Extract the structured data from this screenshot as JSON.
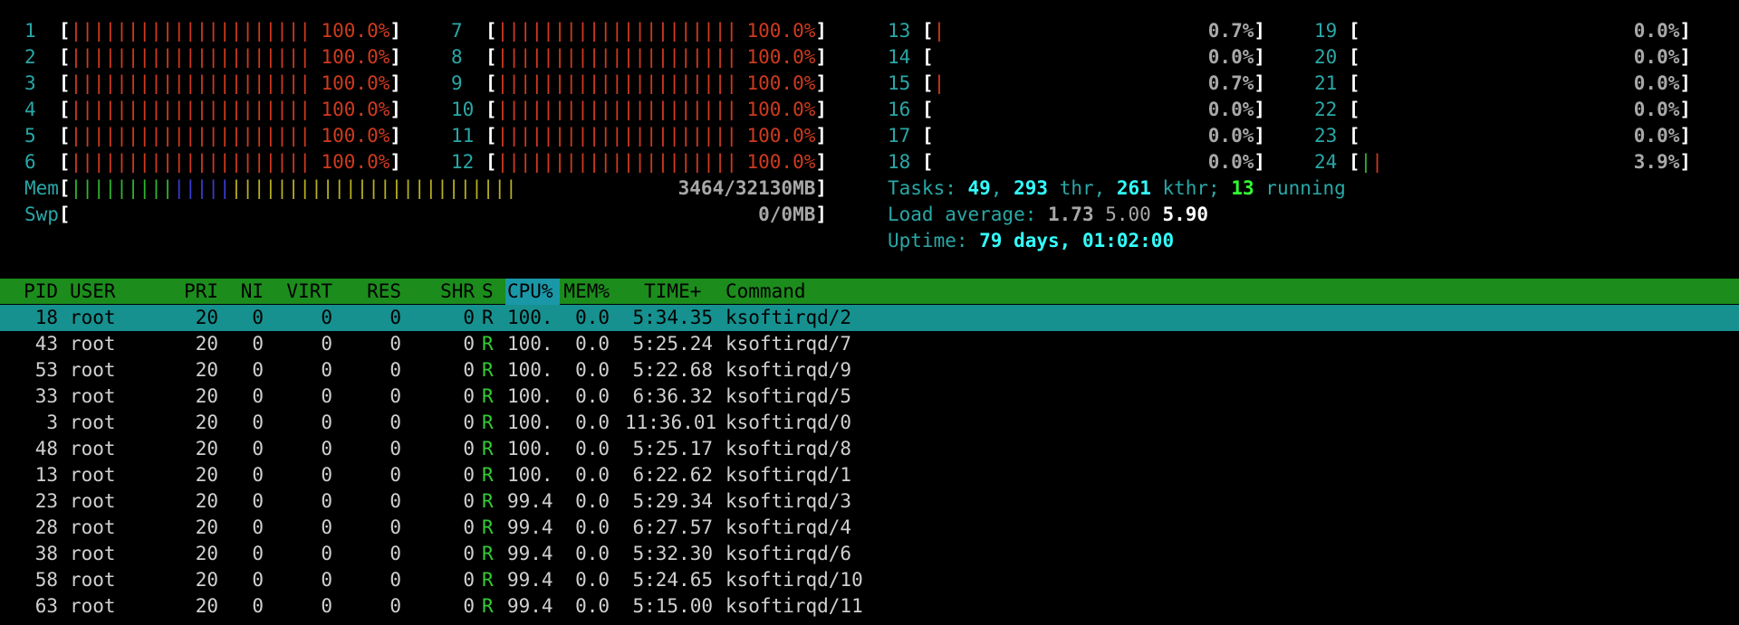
{
  "colors": {
    "label": "#2aa7a7",
    "kernel_bar": "#d03a1e",
    "normal_bar": "#2fb52f",
    "mem_used": "#2fb52f",
    "mem_buffers": "#3b3bd0",
    "mem_cache": "#b8b020",
    "header_bg": "#1c8c1c",
    "selected_bg": "#16918f"
  },
  "cpus": [
    {
      "label": "1",
      "value": "100.0%",
      "pct": 100,
      "segments": [
        {
          "type": "kernel",
          "pct": 100
        }
      ]
    },
    {
      "label": "2",
      "value": "100.0%",
      "pct": 100,
      "segments": [
        {
          "type": "kernel",
          "pct": 100
        }
      ]
    },
    {
      "label": "3",
      "value": "100.0%",
      "pct": 100,
      "segments": [
        {
          "type": "kernel",
          "pct": 100
        }
      ]
    },
    {
      "label": "4",
      "value": "100.0%",
      "pct": 100,
      "segments": [
        {
          "type": "kernel",
          "pct": 100
        }
      ]
    },
    {
      "label": "5",
      "value": "100.0%",
      "pct": 100,
      "segments": [
        {
          "type": "kernel",
          "pct": 100
        }
      ]
    },
    {
      "label": "6",
      "value": "100.0%",
      "pct": 100,
      "segments": [
        {
          "type": "kernel",
          "pct": 100
        }
      ]
    },
    {
      "label": "7",
      "value": "100.0%",
      "pct": 100,
      "segments": [
        {
          "type": "kernel",
          "pct": 100
        }
      ]
    },
    {
      "label": "8",
      "value": "100.0%",
      "pct": 100,
      "segments": [
        {
          "type": "kernel",
          "pct": 100
        }
      ]
    },
    {
      "label": "9",
      "value": "100.0%",
      "pct": 100,
      "segments": [
        {
          "type": "kernel",
          "pct": 100
        }
      ]
    },
    {
      "label": "10",
      "value": "100.0%",
      "pct": 100,
      "segments": [
        {
          "type": "kernel",
          "pct": 100
        }
      ]
    },
    {
      "label": "11",
      "value": "100.0%",
      "pct": 100,
      "segments": [
        {
          "type": "kernel",
          "pct": 100
        }
      ]
    },
    {
      "label": "12",
      "value": "100.0%",
      "pct": 100,
      "segments": [
        {
          "type": "kernel",
          "pct": 100
        }
      ]
    },
    {
      "label": "13",
      "value": "0.7%",
      "pct": 0.7,
      "segments": [
        {
          "type": "kernel",
          "pct": 0.7
        }
      ]
    },
    {
      "label": "14",
      "value": "0.0%",
      "pct": 0,
      "segments": []
    },
    {
      "label": "15",
      "value": "0.7%",
      "pct": 0.7,
      "segments": [
        {
          "type": "kernel",
          "pct": 0.7
        }
      ]
    },
    {
      "label": "16",
      "value": "0.0%",
      "pct": 0,
      "segments": []
    },
    {
      "label": "17",
      "value": "0.0%",
      "pct": 0,
      "segments": []
    },
    {
      "label": "18",
      "value": "0.0%",
      "pct": 0,
      "segments": []
    },
    {
      "label": "19",
      "value": "0.0%",
      "pct": 0,
      "segments": []
    },
    {
      "label": "20",
      "value": "0.0%",
      "pct": 0,
      "segments": []
    },
    {
      "label": "21",
      "value": "0.0%",
      "pct": 0,
      "segments": []
    },
    {
      "label": "22",
      "value": "0.0%",
      "pct": 0,
      "segments": []
    },
    {
      "label": "23",
      "value": "0.0%",
      "pct": 0,
      "segments": []
    },
    {
      "label": "24",
      "value": "3.9%",
      "pct": 3.9,
      "segments": [
        {
          "type": "normal",
          "pct": 1.9
        },
        {
          "type": "kernel",
          "pct": 2.0
        }
      ]
    }
  ],
  "mem": {
    "label": "Mem",
    "value": "3464/32130MB",
    "segments": [
      {
        "type": "mem_used",
        "pct": 12.7
      },
      {
        "type": "mem_buffers",
        "pct": 6.3
      },
      {
        "type": "mem_cache",
        "pct": 38.1
      }
    ]
  },
  "swp": {
    "label": "Swp",
    "value": "0/0MB",
    "segments": []
  },
  "tasks": {
    "label": "Tasks: ",
    "tasks": "49",
    "sep1": ", ",
    "threads": "293",
    "thr_label": " thr, ",
    "kthreads": "261",
    "kthr_label": " kthr; ",
    "running": "13",
    "running_label": " running"
  },
  "load": {
    "label": "Load average: ",
    "one": "1.73",
    "five": "5.00",
    "fifteen": "5.90"
  },
  "uptime": {
    "label": "Uptime: ",
    "value": "79 days, 01:02:00"
  },
  "table": {
    "headers": {
      "pid": "PID",
      "user": "USER",
      "pri": "PRI",
      "ni": "NI",
      "virt": "VIRT",
      "res": "RES",
      "shr": "SHR",
      "s": "S",
      "cpu": "CPU%",
      "mem": "MEM%",
      "time": "TIME+ ",
      "cmd": "Command"
    },
    "rows": [
      {
        "pid": "18",
        "user": "root",
        "pri": "20",
        "ni": "0",
        "virt": "0",
        "res": "0",
        "shr": "0",
        "s": "R",
        "cpu": "100.",
        "mem": "0.0",
        "time": "5:34.35",
        "cmd": "ksoftirqd/2",
        "selected": true
      },
      {
        "pid": "43",
        "user": "root",
        "pri": "20",
        "ni": "0",
        "virt": "0",
        "res": "0",
        "shr": "0",
        "s": "R",
        "cpu": "100.",
        "mem": "0.0",
        "time": "5:25.24",
        "cmd": "ksoftirqd/7"
      },
      {
        "pid": "53",
        "user": "root",
        "pri": "20",
        "ni": "0",
        "virt": "0",
        "res": "0",
        "shr": "0",
        "s": "R",
        "cpu": "100.",
        "mem": "0.0",
        "time": "5:22.68",
        "cmd": "ksoftirqd/9"
      },
      {
        "pid": "33",
        "user": "root",
        "pri": "20",
        "ni": "0",
        "virt": "0",
        "res": "0",
        "shr": "0",
        "s": "R",
        "cpu": "100.",
        "mem": "0.0",
        "time": "6:36.32",
        "cmd": "ksoftirqd/5"
      },
      {
        "pid": "3",
        "user": "root",
        "pri": "20",
        "ni": "0",
        "virt": "0",
        "res": "0",
        "shr": "0",
        "s": "R",
        "cpu": "100.",
        "mem": "0.0",
        "time": "11:36.01",
        "cmd": "ksoftirqd/0"
      },
      {
        "pid": "48",
        "user": "root",
        "pri": "20",
        "ni": "0",
        "virt": "0",
        "res": "0",
        "shr": "0",
        "s": "R",
        "cpu": "100.",
        "mem": "0.0",
        "time": "5:25.17",
        "cmd": "ksoftirqd/8"
      },
      {
        "pid": "13",
        "user": "root",
        "pri": "20",
        "ni": "0",
        "virt": "0",
        "res": "0",
        "shr": "0",
        "s": "R",
        "cpu": "100.",
        "mem": "0.0",
        "time": "6:22.62",
        "cmd": "ksoftirqd/1"
      },
      {
        "pid": "23",
        "user": "root",
        "pri": "20",
        "ni": "0",
        "virt": "0",
        "res": "0",
        "shr": "0",
        "s": "R",
        "cpu": "99.4",
        "mem": "0.0",
        "time": "5:29.34",
        "cmd": "ksoftirqd/3"
      },
      {
        "pid": "28",
        "user": "root",
        "pri": "20",
        "ni": "0",
        "virt": "0",
        "res": "0",
        "shr": "0",
        "s": "R",
        "cpu": "99.4",
        "mem": "0.0",
        "time": "6:27.57",
        "cmd": "ksoftirqd/4"
      },
      {
        "pid": "38",
        "user": "root",
        "pri": "20",
        "ni": "0",
        "virt": "0",
        "res": "0",
        "shr": "0",
        "s": "R",
        "cpu": "99.4",
        "mem": "0.0",
        "time": "5:32.30",
        "cmd": "ksoftirqd/6"
      },
      {
        "pid": "58",
        "user": "root",
        "pri": "20",
        "ni": "0",
        "virt": "0",
        "res": "0",
        "shr": "0",
        "s": "R",
        "cpu": "99.4",
        "mem": "0.0",
        "time": "5:24.65",
        "cmd": "ksoftirqd/10"
      },
      {
        "pid": "63",
        "user": "root",
        "pri": "20",
        "ni": "0",
        "virt": "0",
        "res": "0",
        "shr": "0",
        "s": "R",
        "cpu": "99.4",
        "mem": "0.0",
        "time": "5:15.00",
        "cmd": "ksoftirqd/11"
      }
    ]
  }
}
